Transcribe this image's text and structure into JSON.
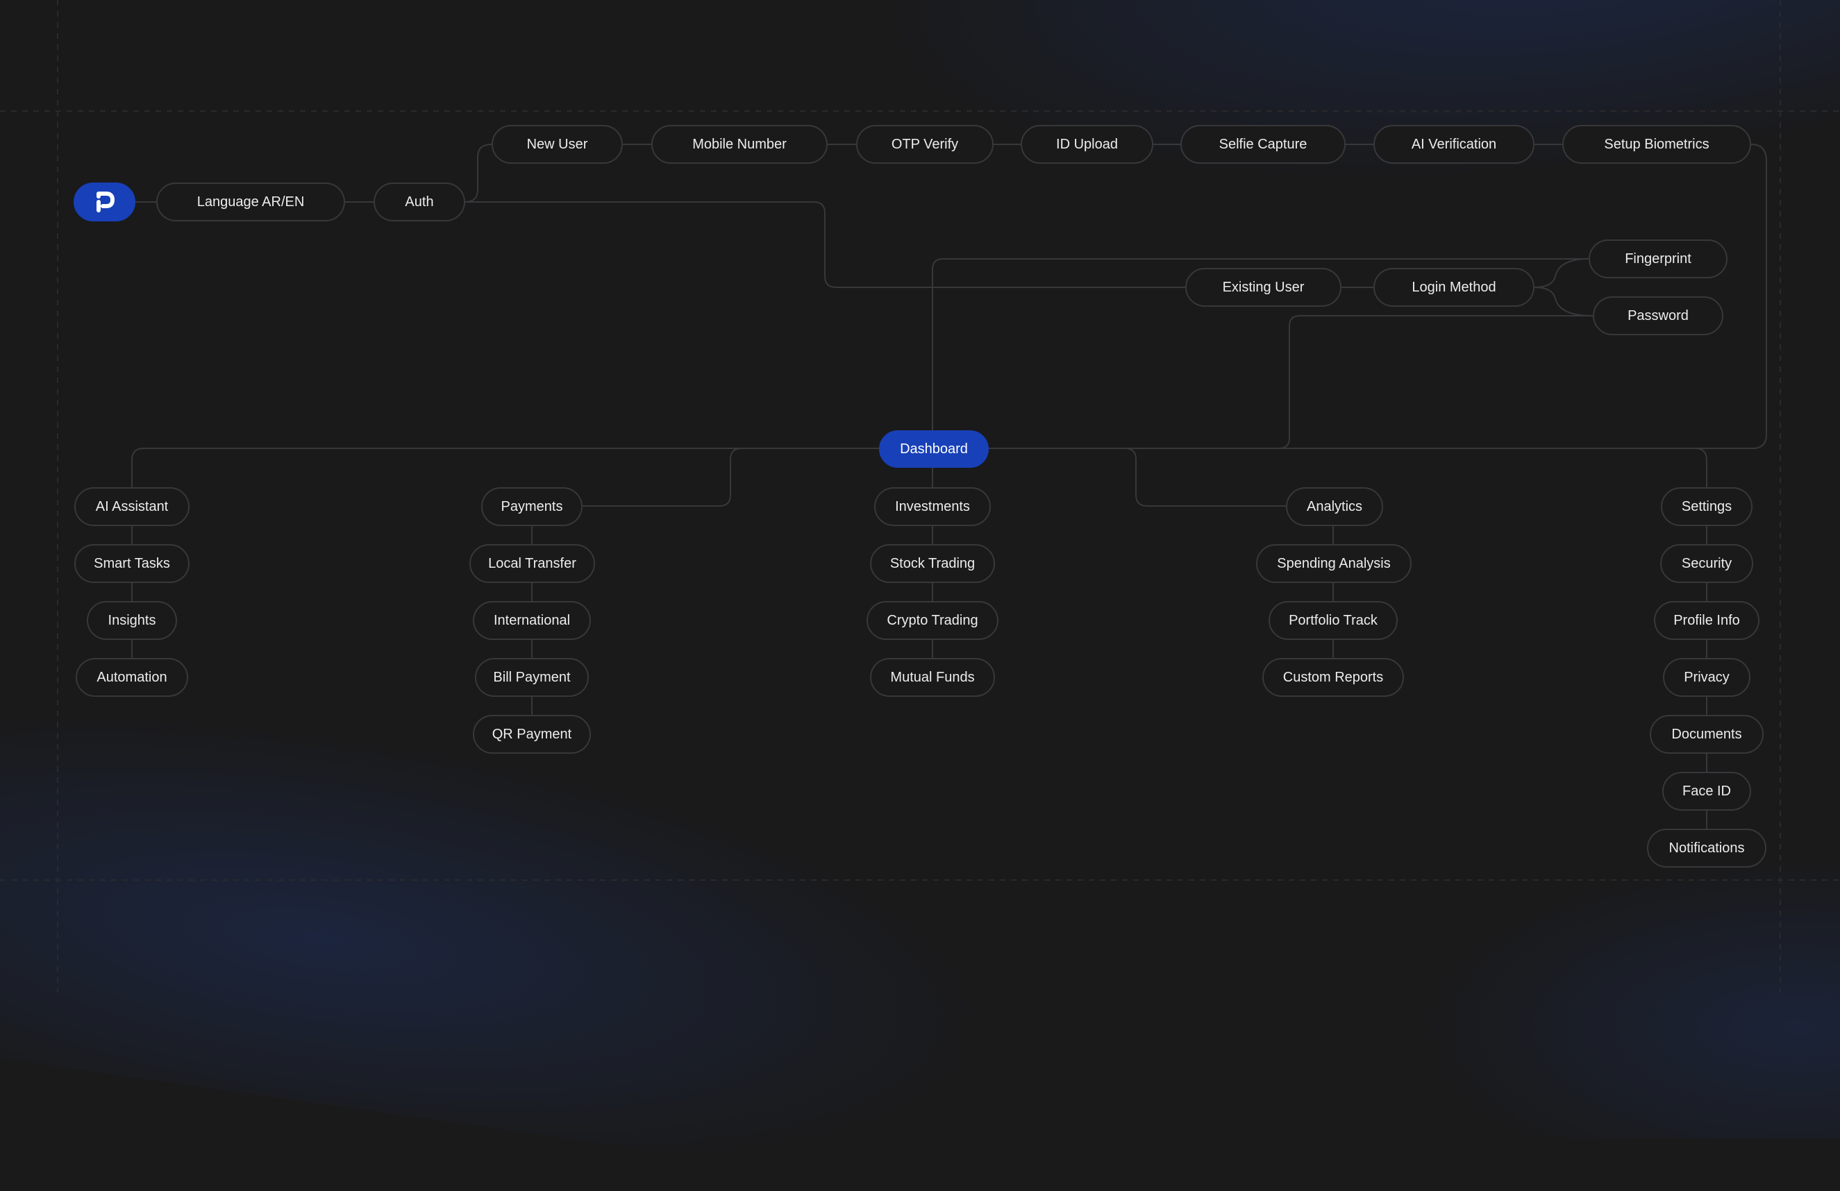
{
  "colors": {
    "background": "#1a1a1b",
    "node_border": "#38383b",
    "connector": "#38383b",
    "accent": "#1840b8",
    "text": "#ededed"
  },
  "logo": {
    "icon": "p-logo-icon"
  },
  "nodes": {
    "language": "Language AR/EN",
    "auth": "Auth",
    "new_user": "New User",
    "mobile_number": "Mobile Number",
    "otp_verify": "OTP Verify",
    "id_upload": "ID Upload",
    "selfie_capture": "Selfie Capture",
    "ai_verification": "AI Verification",
    "setup_biometrics": "Setup Biometrics",
    "existing_user": "Existing User",
    "login_method": "Login Method",
    "fingerprint": "Fingerprint",
    "password": "Password",
    "dashboard": "Dashboard"
  },
  "branches": {
    "ai_assistant": [
      "AI Assistant",
      "Smart Tasks",
      "Insights",
      "Automation"
    ],
    "payments": [
      "Payments",
      "Local Transfer",
      "International",
      "Bill Payment",
      "QR Payment"
    ],
    "investments": [
      "Investments",
      "Stock Trading",
      "Crypto Trading",
      "Mutual Funds"
    ],
    "analytics": [
      "Analytics",
      "Spending Analysis",
      "Portfolio Track",
      "Custom Reports"
    ],
    "settings": [
      "Settings",
      "Security",
      "Profile Info",
      "Privacy",
      "Documents",
      "Face ID",
      "Notifications"
    ]
  }
}
